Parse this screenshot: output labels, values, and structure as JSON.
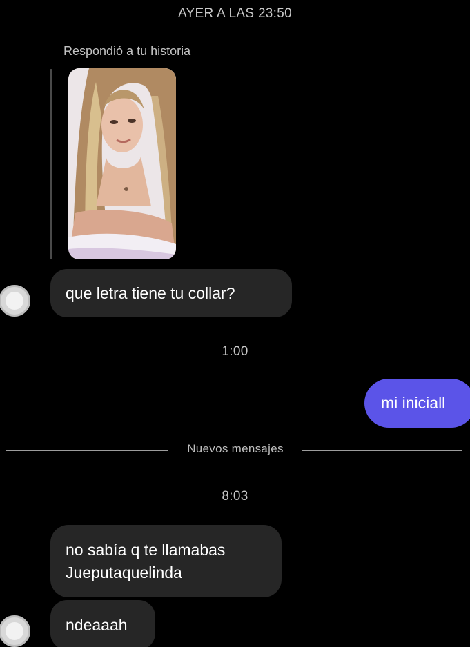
{
  "thread": {
    "timestamps": {
      "first": "AYER A LAS 23:50",
      "second": "1:00",
      "third": "8:03"
    },
    "story_reply_caption": "Respondió a tu historia",
    "divider_label": "Nuevos mensajes",
    "messages": {
      "received_1": "que letra tiene tu collar?",
      "sent_1": "mi iniciall",
      "received_2_line1": "no sabía q te llamabas",
      "received_2_line2": "Jueputaquelinda",
      "received_3": "ndeaaah"
    }
  },
  "colors": {
    "background": "#000000",
    "received_bubble": "#262626",
    "sent_bubble": "#5b54e8"
  },
  "icons": {
    "avatar": "avatar-placeholder-icon",
    "story": "story-thumbnail-photo"
  }
}
